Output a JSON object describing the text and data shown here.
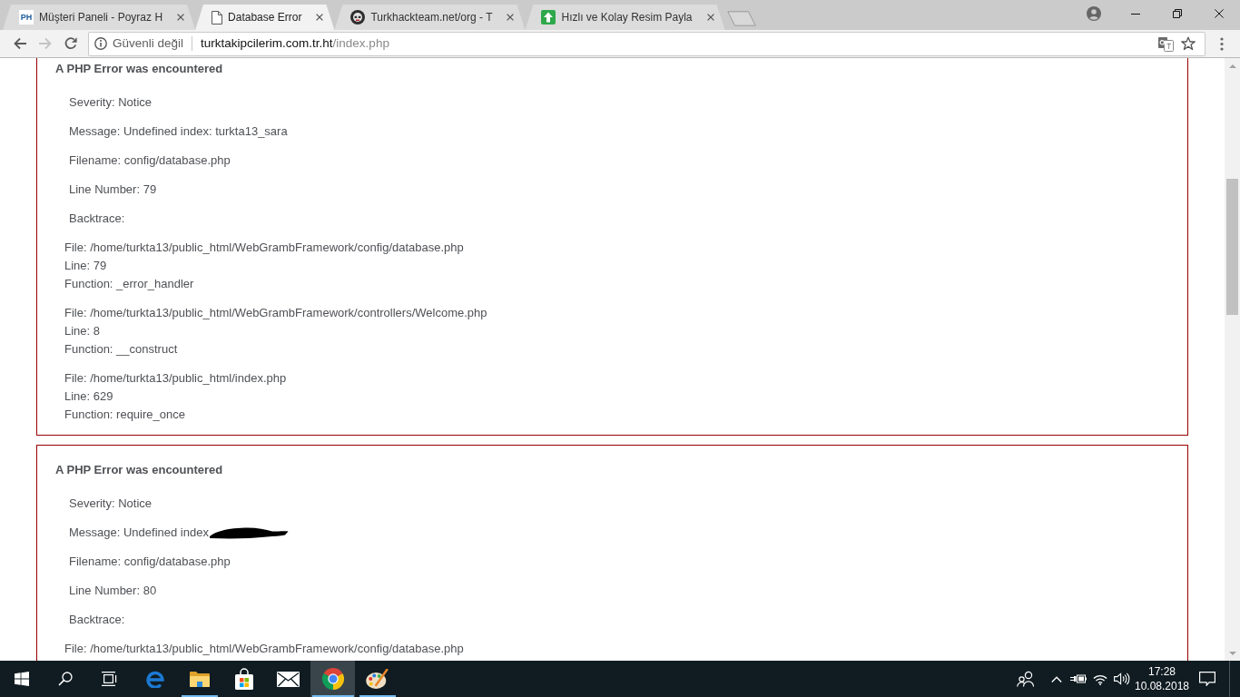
{
  "browser": {
    "tabs": [
      {
        "kind": "monogram",
        "favicon_text": "PH",
        "title": "Müşteri Paneli - Poyraz H",
        "selected": false
      },
      {
        "kind": "document",
        "title": "Database Error",
        "selected": true
      },
      {
        "kind": "emblem",
        "title": "Turkhackteam.net/org - T",
        "selected": false
      },
      {
        "kind": "upload",
        "title": "Hızlı ve Kolay Resim Payla",
        "selected": false
      }
    ],
    "nav_buttons": [
      {
        "kind": "back",
        "disabled": false
      },
      {
        "kind": "forward",
        "disabled": true
      },
      {
        "kind": "reload",
        "disabled": false
      }
    ],
    "address_bar": {
      "security_label": "Güvenli değil",
      "url_host": "turktakipcilerim.com.tr.ht",
      "url_path": "/index.php"
    }
  },
  "page": {
    "errors": [
      {
        "heading": "A PHP Error was encountered",
        "details": [
          {
            "text": "Severity: Notice"
          },
          {
            "text": "Message: Undefined index: turkta13_sara"
          },
          {
            "text": "Filename: config/database.php"
          },
          {
            "text": "Line Number: 79"
          },
          {
            "text": "Backtrace:"
          }
        ],
        "backtrace": [
          {
            "lines": [
              "File: /home/turkta13/public_html/WebGrambFramework/config/database.php",
              "Line: 79",
              "Function: _error_handler"
            ]
          },
          {
            "lines": [
              "File: /home/turkta13/public_html/WebGrambFramework/controllers/Welcome.php",
              "Line: 8",
              "Function: __construct"
            ]
          },
          {
            "lines": [
              "File: /home/turkta13/public_html/index.php",
              "Line: 629",
              "Function: require_once"
            ]
          }
        ]
      },
      {
        "heading": "A PHP Error was encountered",
        "details": [
          {
            "text": "Severity: Notice"
          },
          {
            "text": "Message: Undefined index",
            "redacted": true
          },
          {
            "text": "Filename: config/database.php"
          },
          {
            "text": "Line Number: 80"
          },
          {
            "text": "Backtrace:"
          }
        ],
        "backtrace": [
          {
            "lines": [
              "File: /home/turkta13/public_html/WebGrambFramework/config/database.php"
            ]
          }
        ]
      }
    ]
  },
  "taskbar": {
    "apps": [
      {
        "kind": "edge",
        "running": false,
        "selected": false
      },
      {
        "kind": "explorer",
        "running": true,
        "selected": false
      },
      {
        "kind": "store",
        "running": false,
        "selected": false
      },
      {
        "kind": "mail",
        "running": false,
        "selected": false
      },
      {
        "kind": "chrome",
        "running": true,
        "selected": true
      },
      {
        "kind": "paint",
        "running": true,
        "selected": false
      }
    ],
    "clock": {
      "time": "17:28",
      "date": "10.08.2018"
    }
  }
}
